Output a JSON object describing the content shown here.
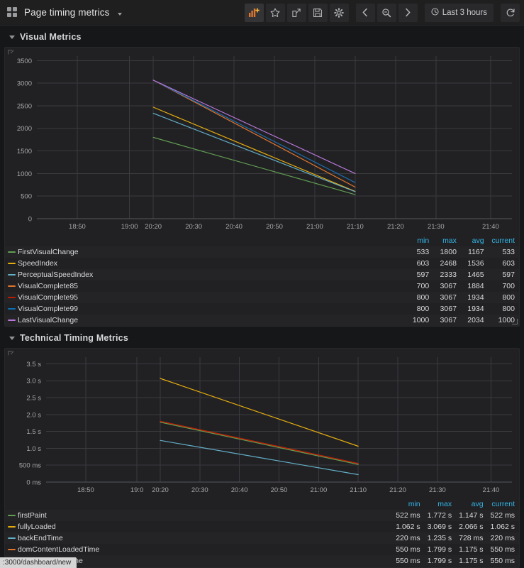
{
  "navbar": {
    "menu_icon": "grid-icon",
    "title": "Page timing metrics",
    "title_caret": "chevron-down-icon",
    "buttons": [
      {
        "name": "add-panel-button",
        "icon": "add-panel-icon",
        "label": ""
      },
      {
        "name": "star-dashboard-button",
        "icon": "star-icon",
        "label": ""
      },
      {
        "name": "share-dashboard-button",
        "icon": "share-icon",
        "label": ""
      },
      {
        "name": "save-dashboard-button",
        "icon": "save-icon",
        "label": ""
      },
      {
        "name": "dashboard-settings-button",
        "icon": "gear-icon",
        "label": ""
      },
      {
        "name": "time-range-back-button",
        "icon": "chevron-left-icon",
        "label": ""
      },
      {
        "name": "zoom-out-button",
        "icon": "magnifier-minus-icon",
        "label": ""
      },
      {
        "name": "time-range-forward-button",
        "icon": "chevron-right-icon",
        "label": ""
      }
    ],
    "time_picker": {
      "icon": "clock-icon",
      "label": "Last 3 hours"
    },
    "refresh": {
      "name": "refresh-button",
      "icon": "refresh-icon"
    }
  },
  "rows": [
    {
      "title": "Visual Metrics"
    },
    {
      "title": "Technical Timing Metrics"
    }
  ],
  "statusbar": {
    "text": ":3000/dashboard/new"
  },
  "legend_headers": {
    "name": "",
    "min": "min",
    "max": "max",
    "avg": "avg",
    "current": "current"
  },
  "chart_data": [
    {
      "type": "line",
      "panel": "Visual Metrics",
      "title": "",
      "xlabel": "",
      "ylabel": "",
      "ylim": [
        0,
        3600
      ],
      "yticks": [
        0,
        500,
        1000,
        1500,
        2000,
        2500,
        3000,
        3500
      ],
      "ytick_labels": [
        "0",
        "500",
        "1000",
        "1500",
        "2000",
        "2500",
        "3000",
        "3500"
      ],
      "xticks": [
        "18:50",
        "19:00",
        "20:20",
        "20:30",
        "20:40",
        "20:50",
        "21:00",
        "21:10",
        "21:20",
        "21:30",
        "21:40"
      ],
      "xtick_positions": [
        0.085,
        0.195,
        0.245,
        0.33,
        0.415,
        0.5,
        0.585,
        0.67,
        0.755,
        0.84,
        0.955
      ],
      "x_data_start": "20:20",
      "x_data_end": "21:10",
      "grid": true,
      "legend_position": "bottom-table",
      "series": [
        {
          "name": "FirstVisualChange",
          "color": "#629e51",
          "values": [
            1800,
            533
          ],
          "min": "533",
          "max": "1800",
          "avg": "1167",
          "current": "533"
        },
        {
          "name": "SpeedIndex",
          "color": "#e5ac0e",
          "values": [
            2468,
            603
          ],
          "min": "603",
          "max": "2468",
          "avg": "1536",
          "current": "603"
        },
        {
          "name": "PerceptualSpeedIndex",
          "color": "#64b0c8",
          "values": [
            2333,
            597
          ],
          "min": "597",
          "max": "2333",
          "avg": "1465",
          "current": "597"
        },
        {
          "name": "VisualComplete85",
          "color": "#e0752d",
          "values": [
            3067,
            700
          ],
          "min": "700",
          "max": "3067",
          "avg": "1884",
          "current": "700"
        },
        {
          "name": "VisualComplete95",
          "color": "#bf1b00",
          "values": [
            3067,
            800
          ],
          "min": "800",
          "max": "3067",
          "avg": "1934",
          "current": "800"
        },
        {
          "name": "VisualComplete99",
          "color": "#0a6fb5",
          "values": [
            3067,
            800
          ],
          "min": "800",
          "max": "3067",
          "avg": "1934",
          "current": "800"
        },
        {
          "name": "LastVisualChange",
          "color": "#b877d9",
          "values": [
            3067,
            1000
          ],
          "min": "1000",
          "max": "3067",
          "avg": "2034",
          "current": "1000"
        }
      ]
    },
    {
      "type": "line",
      "panel": "Technical Timing Metrics",
      "title": "",
      "xlabel": "",
      "ylabel": "",
      "ylim": [
        0,
        3700
      ],
      "yticks": [
        0,
        500,
        1000,
        1500,
        2000,
        2500,
        3000,
        3500
      ],
      "ytick_labels": [
        "0 ms",
        "500 ms",
        "1.0 s",
        "1.5 s",
        "2.0 s",
        "2.5 s",
        "3.0 s",
        "3.5 s"
      ],
      "xticks": [
        "18:50",
        "19:0",
        "20:20",
        "20:30",
        "20:40",
        "20:50",
        "21:00",
        "21:10",
        "21:20",
        "21:30",
        "21:40"
      ],
      "xtick_positions": [
        0.085,
        0.195,
        0.245,
        0.33,
        0.415,
        0.5,
        0.585,
        0.67,
        0.755,
        0.84,
        0.955
      ],
      "x_data_start": "20:20",
      "x_data_end": "21:10",
      "grid": true,
      "legend_position": "bottom-table",
      "series": [
        {
          "name": "firstPaint",
          "color": "#629e51",
          "values": [
            1772,
            522
          ],
          "min": "522 ms",
          "max": "1.772 s",
          "avg": "1.147 s",
          "current": "522 ms"
        },
        {
          "name": "fullyLoaded",
          "color": "#e5ac0e",
          "values": [
            3069,
            1062
          ],
          "min": "1.062 s",
          "max": "3.069 s",
          "avg": "2.066 s",
          "current": "1.062 s"
        },
        {
          "name": "backEndTime",
          "color": "#64b0c8",
          "values": [
            1235,
            220
          ],
          "min": "220 ms",
          "max": "1.235 s",
          "avg": "728 ms",
          "current": "220 ms"
        },
        {
          "name": "domContentLoadedTime",
          "color": "#e0752d",
          "values": [
            1799,
            550
          ],
          "min": "550 ms",
          "max": "1.799 s",
          "avg": "1.175 s",
          "current": "550 ms"
        },
        {
          "name": "domInteractiveTime",
          "color": "#bf1b00",
          "values": [
            1799,
            550
          ],
          "min": "550 ms",
          "max": "1.799 s",
          "avg": "1.175 s",
          "current": "550 ms"
        }
      ]
    }
  ]
}
